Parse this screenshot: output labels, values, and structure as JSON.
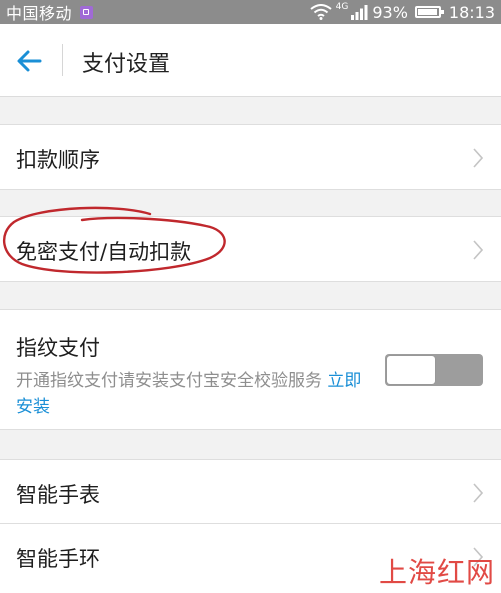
{
  "status_bar": {
    "carrier": "中国移动",
    "network": "4G",
    "battery": "93%",
    "time": "18:13"
  },
  "header": {
    "title": "支付设置"
  },
  "settings": {
    "deduction_order": {
      "label": "扣款顺序"
    },
    "password_free": {
      "label": "免密支付/自动扣款"
    },
    "fingerprint": {
      "label": "指纹支付",
      "description": "开通指纹支付请安装支付宝安全校验服务",
      "install_link": "立即安装",
      "toggle_on": false
    },
    "smartwatch": {
      "label": "智能手表"
    },
    "smartband": {
      "label": "智能手环"
    }
  },
  "annotation": {
    "color": "#c0282d"
  },
  "watermark": {
    "text": "上海红网"
  },
  "colors": {
    "link": "#1a8fd6",
    "back_arrow": "#1a8fd6",
    "status_bar": "#8c8c8c"
  }
}
